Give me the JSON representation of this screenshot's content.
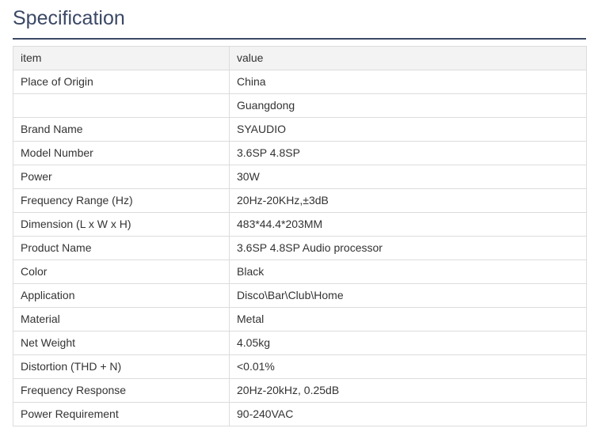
{
  "page": {
    "title": "Specification"
  },
  "table": {
    "header": {
      "item": "item",
      "value": "value"
    },
    "rows": [
      {
        "item": "Place of Origin",
        "value": "China"
      },
      {
        "item": "",
        "value": "Guangdong"
      },
      {
        "item": "Brand Name",
        "value": "SYAUDIO"
      },
      {
        "item": "Model Number",
        "value": "3.6SP 4.8SP"
      },
      {
        "item": "Power",
        "value": "30W"
      },
      {
        "item": "Frequency Range (Hz)",
        "value": "20Hz-20KHz,±3dB"
      },
      {
        "item": "Dimension (L x W x H)",
        "value": "483*44.4*203MM"
      },
      {
        "item": "Product Name",
        "value": "3.6SP 4.8SP Audio processor"
      },
      {
        "item": "Color",
        "value": "Black"
      },
      {
        "item": "Application",
        "value": "Disco\\Bar\\Club\\Home"
      },
      {
        "item": "Material",
        "value": "Metal"
      },
      {
        "item": "Net Weight",
        "value": "4.05kg"
      },
      {
        "item": "Distortion (THD + N)",
        "value": "<0.01%"
      },
      {
        "item": "Frequency Response",
        "value": "20Hz-20kHz, 0.25dB"
      },
      {
        "item": "Power Requirement",
        "value": "90-240VAC"
      }
    ]
  },
  "colors": {
    "title": "#3b4866",
    "rule": "#3d4a66",
    "header_bg": "#f3f3f3",
    "border": "#dcdcdc",
    "text": "#333333"
  }
}
